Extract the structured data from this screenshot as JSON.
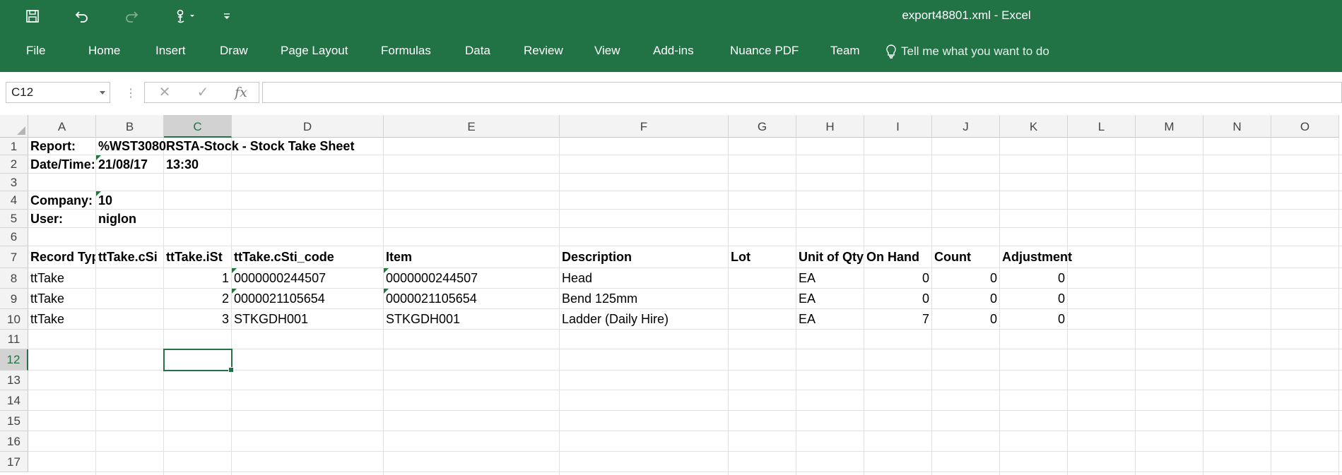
{
  "app": {
    "title": "export48801.xml  -  Excel",
    "accent": "#217346"
  },
  "quick_access": [
    "save-icon",
    "undo-icon",
    "redo-icon",
    "touch-mode-icon",
    "customize-qat-icon"
  ],
  "ribbon": {
    "tabs": [
      "File",
      "Home",
      "Insert",
      "Draw",
      "Page Layout",
      "Formulas",
      "Data",
      "Review",
      "View",
      "Add-ins",
      "Nuance PDF",
      "Team"
    ],
    "tell_me": "Tell me what you want to do"
  },
  "formula_bar": {
    "name_box": "C12",
    "formula": ""
  },
  "columns": [
    "A",
    "B",
    "C",
    "D",
    "E",
    "F",
    "G",
    "H",
    "I",
    "J",
    "K",
    "L",
    "M",
    "N",
    "O"
  ],
  "rows": [
    "1",
    "2",
    "3",
    "4",
    "5",
    "6",
    "7",
    "8",
    "9",
    "10",
    "11",
    "12",
    "13",
    "14",
    "15",
    "16",
    "17"
  ],
  "selected_cell": "C12",
  "cells": {
    "A1": "Report:",
    "B1": "%WST3080RSTA-Stock - Stock Take Sheet",
    "A2": "Date/Time:",
    "B2": "21/08/17",
    "C2": "13:30",
    "A4": "Company:",
    "B4": "10",
    "A5": "User:",
    "B5": "niglon",
    "A7": "Record Type",
    "B7": "ttTake.cSi",
    "C7": "ttTake.iSt",
    "D7": "ttTake.cSti_code",
    "E7": "Item",
    "F7": "Description",
    "G7": "Lot",
    "H7": "Unit of Qty",
    "I7": "On Hand",
    "J7": "Count",
    "K7": "Adjustment",
    "A8": "ttTake",
    "C8": "1",
    "D8": "0000000244507",
    "E8": "0000000244507",
    "F8": "Head",
    "H8": "EA",
    "I8": "0",
    "J8": "0",
    "K8": "0",
    "A9": "ttTake",
    "C9": "2",
    "D9": "0000021105654",
    "E9": "0000021105654",
    "F9": "Bend 125mm",
    "H9": "EA",
    "I9": "0",
    "J9": "0",
    "K9": "0",
    "A10": "ttTake",
    "C10": "3",
    "D10": "STKGDH001",
    "E10": "STKGDH001",
    "F10": "Ladder (Daily Hire)",
    "H10": "EA",
    "I10": "7",
    "J10": "0",
    "K10": "0"
  }
}
